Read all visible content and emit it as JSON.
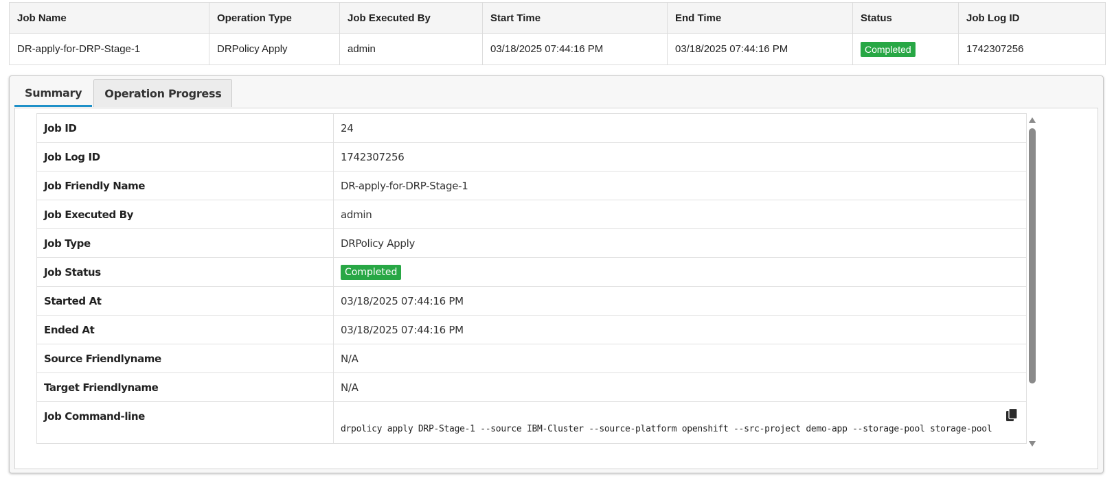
{
  "jobs_table": {
    "headers": [
      "Job Name",
      "Operation Type",
      "Job Executed By",
      "Start Time",
      "End Time",
      "Status",
      "Job Log ID"
    ],
    "row": {
      "job_name": "DR-apply-for-DRP-Stage-1",
      "operation_type": "DRPolicy Apply",
      "executed_by": "admin",
      "start_time": "03/18/2025 07:44:16 PM",
      "end_time": "03/18/2025 07:44:16 PM",
      "status": "Completed",
      "job_log_id": "1742307256"
    }
  },
  "tabs": [
    {
      "label": "Summary",
      "active": true
    },
    {
      "label": "Operation Progress",
      "active": false
    }
  ],
  "details": [
    {
      "key": "Job ID",
      "value": "24"
    },
    {
      "key": "Job Log ID",
      "value": "1742307256"
    },
    {
      "key": "Job Friendly Name",
      "value": "DR-apply-for-DRP-Stage-1"
    },
    {
      "key": "Job Executed By",
      "value": "admin"
    },
    {
      "key": "Job Type",
      "value": "DRPolicy Apply"
    },
    {
      "key": "Job Status",
      "value": "Completed"
    },
    {
      "key": "Started At",
      "value": "03/18/2025 07:44:16 PM"
    },
    {
      "key": "Ended At",
      "value": "03/18/2025 07:44:16 PM"
    },
    {
      "key": "Source Friendlyname",
      "value": "N/A"
    },
    {
      "key": "Target Friendlyname",
      "value": "N/A"
    },
    {
      "key": "Job Command-line",
      "value": "drpolicy apply DRP-Stage-1 --source IBM-Cluster --source-platform openshift --src-project demo-app --storage-pool storage-pool"
    }
  ],
  "icons": {
    "copy": "copy-icon",
    "scroll_up": "triangle-up-icon",
    "scroll_down": "triangle-down-icon"
  },
  "colors": {
    "status_green": "#28a745",
    "active_tab_underline": "#1e90c8",
    "header_bg": "#f5f5f5"
  }
}
